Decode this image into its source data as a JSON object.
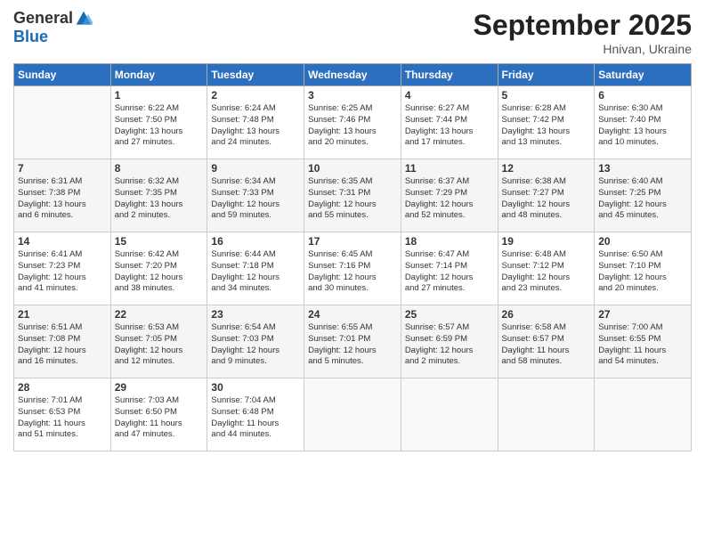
{
  "header": {
    "logo_general": "General",
    "logo_blue": "Blue",
    "month": "September 2025",
    "location": "Hnivan, Ukraine"
  },
  "weekdays": [
    "Sunday",
    "Monday",
    "Tuesday",
    "Wednesday",
    "Thursday",
    "Friday",
    "Saturday"
  ],
  "weeks": [
    [
      {
        "day": "",
        "info": ""
      },
      {
        "day": "1",
        "info": "Sunrise: 6:22 AM\nSunset: 7:50 PM\nDaylight: 13 hours\nand 27 minutes."
      },
      {
        "day": "2",
        "info": "Sunrise: 6:24 AM\nSunset: 7:48 PM\nDaylight: 13 hours\nand 24 minutes."
      },
      {
        "day": "3",
        "info": "Sunrise: 6:25 AM\nSunset: 7:46 PM\nDaylight: 13 hours\nand 20 minutes."
      },
      {
        "day": "4",
        "info": "Sunrise: 6:27 AM\nSunset: 7:44 PM\nDaylight: 13 hours\nand 17 minutes."
      },
      {
        "day": "5",
        "info": "Sunrise: 6:28 AM\nSunset: 7:42 PM\nDaylight: 13 hours\nand 13 minutes."
      },
      {
        "day": "6",
        "info": "Sunrise: 6:30 AM\nSunset: 7:40 PM\nDaylight: 13 hours\nand 10 minutes."
      }
    ],
    [
      {
        "day": "7",
        "info": "Sunrise: 6:31 AM\nSunset: 7:38 PM\nDaylight: 13 hours\nand 6 minutes."
      },
      {
        "day": "8",
        "info": "Sunrise: 6:32 AM\nSunset: 7:35 PM\nDaylight: 13 hours\nand 2 minutes."
      },
      {
        "day": "9",
        "info": "Sunrise: 6:34 AM\nSunset: 7:33 PM\nDaylight: 12 hours\nand 59 minutes."
      },
      {
        "day": "10",
        "info": "Sunrise: 6:35 AM\nSunset: 7:31 PM\nDaylight: 12 hours\nand 55 minutes."
      },
      {
        "day": "11",
        "info": "Sunrise: 6:37 AM\nSunset: 7:29 PM\nDaylight: 12 hours\nand 52 minutes."
      },
      {
        "day": "12",
        "info": "Sunrise: 6:38 AM\nSunset: 7:27 PM\nDaylight: 12 hours\nand 48 minutes."
      },
      {
        "day": "13",
        "info": "Sunrise: 6:40 AM\nSunset: 7:25 PM\nDaylight: 12 hours\nand 45 minutes."
      }
    ],
    [
      {
        "day": "14",
        "info": "Sunrise: 6:41 AM\nSunset: 7:23 PM\nDaylight: 12 hours\nand 41 minutes."
      },
      {
        "day": "15",
        "info": "Sunrise: 6:42 AM\nSunset: 7:20 PM\nDaylight: 12 hours\nand 38 minutes."
      },
      {
        "day": "16",
        "info": "Sunrise: 6:44 AM\nSunset: 7:18 PM\nDaylight: 12 hours\nand 34 minutes."
      },
      {
        "day": "17",
        "info": "Sunrise: 6:45 AM\nSunset: 7:16 PM\nDaylight: 12 hours\nand 30 minutes."
      },
      {
        "day": "18",
        "info": "Sunrise: 6:47 AM\nSunset: 7:14 PM\nDaylight: 12 hours\nand 27 minutes."
      },
      {
        "day": "19",
        "info": "Sunrise: 6:48 AM\nSunset: 7:12 PM\nDaylight: 12 hours\nand 23 minutes."
      },
      {
        "day": "20",
        "info": "Sunrise: 6:50 AM\nSunset: 7:10 PM\nDaylight: 12 hours\nand 20 minutes."
      }
    ],
    [
      {
        "day": "21",
        "info": "Sunrise: 6:51 AM\nSunset: 7:08 PM\nDaylight: 12 hours\nand 16 minutes."
      },
      {
        "day": "22",
        "info": "Sunrise: 6:53 AM\nSunset: 7:05 PM\nDaylight: 12 hours\nand 12 minutes."
      },
      {
        "day": "23",
        "info": "Sunrise: 6:54 AM\nSunset: 7:03 PM\nDaylight: 12 hours\nand 9 minutes."
      },
      {
        "day": "24",
        "info": "Sunrise: 6:55 AM\nSunset: 7:01 PM\nDaylight: 12 hours\nand 5 minutes."
      },
      {
        "day": "25",
        "info": "Sunrise: 6:57 AM\nSunset: 6:59 PM\nDaylight: 12 hours\nand 2 minutes."
      },
      {
        "day": "26",
        "info": "Sunrise: 6:58 AM\nSunset: 6:57 PM\nDaylight: 11 hours\nand 58 minutes."
      },
      {
        "day": "27",
        "info": "Sunrise: 7:00 AM\nSunset: 6:55 PM\nDaylight: 11 hours\nand 54 minutes."
      }
    ],
    [
      {
        "day": "28",
        "info": "Sunrise: 7:01 AM\nSunset: 6:53 PM\nDaylight: 11 hours\nand 51 minutes."
      },
      {
        "day": "29",
        "info": "Sunrise: 7:03 AM\nSunset: 6:50 PM\nDaylight: 11 hours\nand 47 minutes."
      },
      {
        "day": "30",
        "info": "Sunrise: 7:04 AM\nSunset: 6:48 PM\nDaylight: 11 hours\nand 44 minutes."
      },
      {
        "day": "",
        "info": ""
      },
      {
        "day": "",
        "info": ""
      },
      {
        "day": "",
        "info": ""
      },
      {
        "day": "",
        "info": ""
      }
    ]
  ]
}
